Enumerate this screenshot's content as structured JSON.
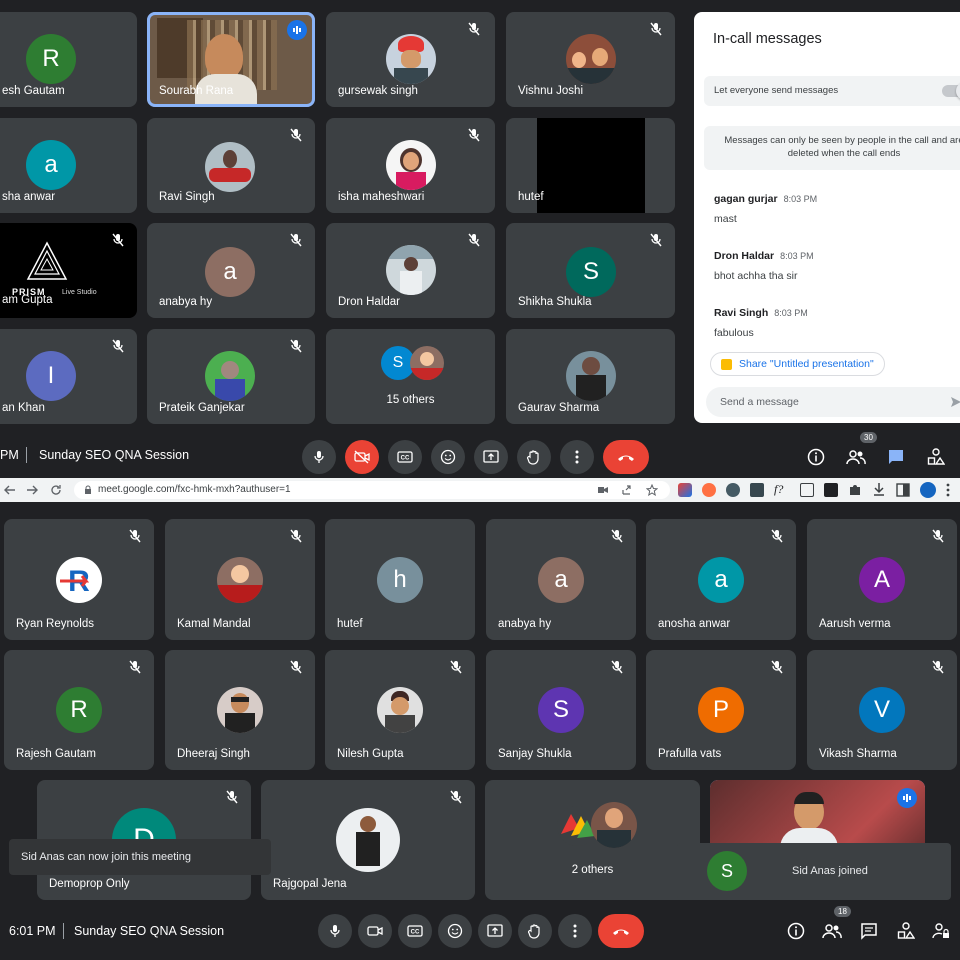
{
  "top": {
    "tiles": [
      {
        "name": "Rajesh Gautam",
        "display": "esh Gautam",
        "initial": "R",
        "color": "#2e7d32"
      },
      {
        "name": "Sourabh Rana",
        "display": "Sourabh Rana"
      },
      {
        "name": "gursewak singh",
        "display": "gursewak singh"
      },
      {
        "name": "Vishnu Joshi",
        "display": "Vishnu Joshi"
      },
      {
        "name": "anosha anwar",
        "display": "sha anwar",
        "initial": "a",
        "color": "#0097a7"
      },
      {
        "name": "Ravi Singh",
        "display": "Ravi Singh"
      },
      {
        "name": "isha maheshwari",
        "display": "isha maheshwari"
      },
      {
        "name": "hutef",
        "display": "hutef"
      },
      {
        "name": "am Gupta",
        "display": "am Gupta"
      },
      {
        "name": "anabya hy",
        "display": "anabya hy",
        "initial": "a",
        "color": "#8d6e63"
      },
      {
        "name": "Dron Haldar",
        "display": "Dron Haldar"
      },
      {
        "name": "Shikha Shukla",
        "display": "Shikha Shukla",
        "initial": "S",
        "color": "#00695c"
      },
      {
        "name": "an Khan",
        "display": "an Khan",
        "initial": "I",
        "color": "#5c6bc0"
      },
      {
        "name": "Prateik Ganjekar",
        "display": "Prateik Ganjekar"
      },
      {
        "name": "15 others",
        "display": "15 others",
        "initial": "S",
        "color": "#0288d1"
      },
      {
        "name": "Gaurav Sharma",
        "display": "Gaurav Sharma"
      }
    ],
    "prism_logo": "PRISM",
    "prism_sub": "Live Studio",
    "time": "PM",
    "meeting_title": "Sunday SEO QNA Session",
    "participants_count": "30"
  },
  "panel": {
    "title": "In-call messages",
    "toggle_label": "Let everyone send messages",
    "info_text": "Messages can only be seen by people in the call and are deleted when the call ends",
    "messages": [
      {
        "sender": "gagan gurjar",
        "time": "8:03 PM",
        "text": "mast"
      },
      {
        "sender": "Dron Haldar",
        "time": "8:03 PM",
        "text": "bhot achha tha sir"
      },
      {
        "sender": "Ravi Singh",
        "time": "8:03 PM",
        "text": "fabulous"
      }
    ],
    "share_label": "Share \"Untitled presentation\"",
    "input_placeholder": "Send a message"
  },
  "browser": {
    "url": "meet.google.com/fxc-hmk-mxh?authuser=1"
  },
  "bottom": {
    "row1": [
      {
        "name": "Ryan Reynolds",
        "initial": "R",
        "color": "#ffffff"
      },
      {
        "name": "Kamal Mandal"
      },
      {
        "name": "hutef",
        "initial": "h",
        "color": "#78909c"
      },
      {
        "name": "anabya hy",
        "initial": "a",
        "color": "#8d6e63"
      },
      {
        "name": "anosha anwar",
        "initial": "a",
        "color": "#0097a7"
      },
      {
        "name": "Aarush verma",
        "initial": "A",
        "color": "#7b1fa2"
      }
    ],
    "row2": [
      {
        "name": "Rajesh Gautam",
        "initial": "R",
        "color": "#2e7d32"
      },
      {
        "name": "Dheeraj Singh"
      },
      {
        "name": "Nilesh Gupta"
      },
      {
        "name": "Sanjay Shukla",
        "initial": "S",
        "color": "#5e35b1"
      },
      {
        "name": "Prafulla vats",
        "initial": "P",
        "color": "#ef6c00"
      },
      {
        "name": "Vikash Sharma",
        "initial": "V",
        "color": "#0277bd"
      }
    ],
    "row3": [
      {
        "name": "Demoprop Only",
        "initial": "D",
        "color": "#00897b"
      },
      {
        "name": "Rajgopal Jena"
      },
      {
        "name": "2 others"
      }
    ],
    "toast_left": "Sid Anas can now join this meeting",
    "toast_right": "Sid Anas joined",
    "toast_initial": "S",
    "time": "6:01 PM",
    "meeting_title": "Sunday SEO QNA Session",
    "participants_count": "18"
  },
  "colors": {
    "accent_blue": "#8ab4f8",
    "hangup_red": "#ea4335",
    "tile_bg": "#3c4043",
    "page_bg": "#202124"
  }
}
